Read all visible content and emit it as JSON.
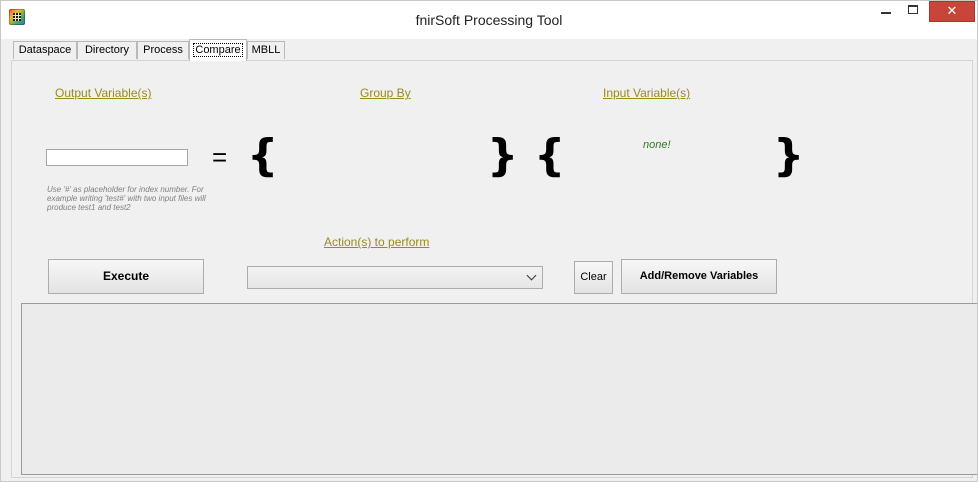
{
  "window": {
    "title": "fnirSoft Processing Tool",
    "close_glyph": "✕"
  },
  "tabs": [
    {
      "label": "Dataspace",
      "active": false
    },
    {
      "label": "Directory",
      "active": false
    },
    {
      "label": "Process",
      "active": false
    },
    {
      "label": "Compare",
      "active": true
    },
    {
      "label": "MBLL",
      "active": false
    }
  ],
  "compare": {
    "output_heading": "Output Variable(s)",
    "group_by_heading": "Group By",
    "input_heading": "Input Variable(s)",
    "output_value": "",
    "equals": "=",
    "open_brace": "{",
    "close_brace": "}",
    "input_none": "none!",
    "hint": "Use '#' as placeholder for index number. For example writing 'test#' with two input files will produce test1 and test2",
    "actions_heading": "Action(s) to perform",
    "action_selected": "",
    "execute_label": "Execute",
    "clear_label": "Clear",
    "add_remove_label": "Add/Remove Variables",
    "output_log": ""
  },
  "icons": {
    "app": "app-grid-icon",
    "minimize": "minimize-icon",
    "maximize": "maximize-icon",
    "close": "close-icon",
    "dropdown": "chevron-down-icon"
  },
  "colors": {
    "heading_olive": "#9a8a1a",
    "none_green": "#2e7d1e",
    "close_red": "#c7463a"
  }
}
